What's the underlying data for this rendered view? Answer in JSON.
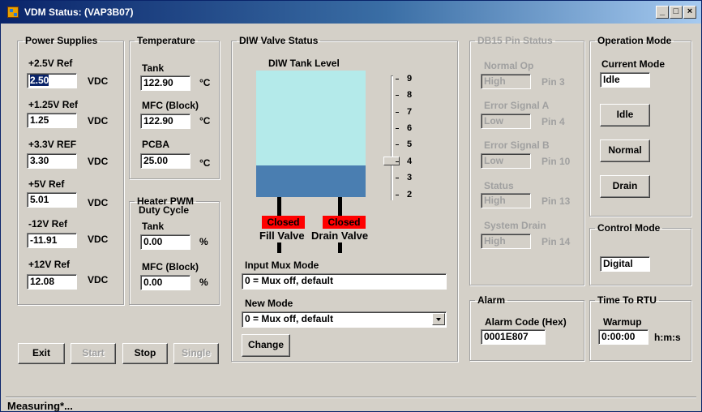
{
  "window": {
    "title": "VDM Status: (VAP3B07)"
  },
  "power": {
    "legend": "Power Supplies",
    "rows": [
      {
        "label": "+2.5V Ref",
        "value": "2.50",
        "unit": "VDC"
      },
      {
        "label": "+1.25V Ref",
        "value": "1.25",
        "unit": "VDC"
      },
      {
        "label": "+3.3V REF",
        "value": "3.30",
        "unit": "VDC"
      },
      {
        "label": "+5V Ref",
        "value": "5.01",
        "unit": "VDC"
      },
      {
        "label": "-12V Ref",
        "value": "-11.91",
        "unit": "VDC"
      },
      {
        "label": "+12V Ref",
        "value": "12.08",
        "unit": "VDC"
      }
    ]
  },
  "temperature": {
    "legend": "Temperature",
    "rows": [
      {
        "label": "Tank",
        "value": "122.90",
        "unit": "°C"
      },
      {
        "label": "MFC (Block)",
        "value": "122.90",
        "unit": "°C"
      },
      {
        "label": "PCBA",
        "value": "25.00",
        "unit": "°C"
      }
    ]
  },
  "heater": {
    "legend_line1": "Heater PWM",
    "legend_line2": "Duty Cycle",
    "rows": [
      {
        "label": "Tank",
        "value": "0.00",
        "unit": "%"
      },
      {
        "label": "MFC (Block)",
        "value": "0.00",
        "unit": "%"
      }
    ]
  },
  "diw": {
    "legend": "DIW Valve Status",
    "tank_title": "DIW Tank Level",
    "scale": [
      "9",
      "8",
      "7",
      "6",
      "5",
      "4",
      "3",
      "2"
    ],
    "slider_value": "4",
    "fill_valve_status": "Closed",
    "drain_valve_status": "Closed",
    "fill_valve_label": "Fill Valve",
    "drain_valve_label": "Drain Valve",
    "input_mux_label": "Input Mux Mode",
    "input_mux_value": "0 = Mux off, default",
    "new_mode_label": "New Mode",
    "new_mode_value": "0 = Mux off, default",
    "change_button": "Change"
  },
  "db15": {
    "legend": "DB15 Pin Status",
    "rows": [
      {
        "label": "Normal Op",
        "value": "High",
        "pin": "Pin 3"
      },
      {
        "label": "Error Signal A",
        "value": "Low",
        "pin": "Pin 4"
      },
      {
        "label": "Error Signal B",
        "value": "Low",
        "pin": "Pin 10"
      },
      {
        "label": "Status",
        "value": "High",
        "pin": "Pin 13"
      },
      {
        "label": "System Drain",
        "value": "High",
        "pin": "Pin 14"
      }
    ]
  },
  "operation": {
    "legend": "Operation Mode",
    "current_label": "Current Mode",
    "current_value": "Idle",
    "buttons": [
      "Idle",
      "Normal",
      "Drain"
    ]
  },
  "control": {
    "legend": "Control Mode",
    "value": "Digital"
  },
  "alarm": {
    "legend": "Alarm",
    "label": "Alarm Code (Hex)",
    "value": "0001E807"
  },
  "rtu": {
    "legend": "Time To RTU",
    "label": "Warmup",
    "value": "0:00:00",
    "unit": "h:m:s"
  },
  "actions": {
    "exit": "Exit",
    "start": "Start",
    "stop": "Stop",
    "single": "Single"
  },
  "status": {
    "text": "Measuring*..."
  },
  "colors": {
    "titlebar_start": "#0a246a",
    "titlebar_end": "#a6caf0",
    "tank_empty": "#b4eaea",
    "tank_water": "#4a7eb1",
    "valve_closed": "#ff0000"
  }
}
